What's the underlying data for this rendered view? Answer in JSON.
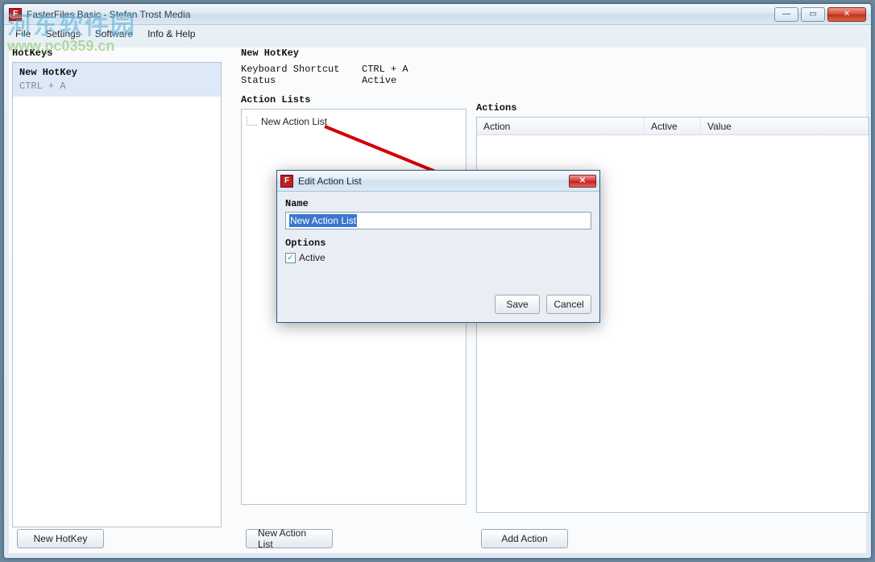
{
  "window": {
    "title": "FasterFiles Basic - Stefan Trost Media",
    "app_icon_letter": "F"
  },
  "menu": {
    "file": "File",
    "settings": "Settings",
    "software": "Software",
    "info": "Info & Help"
  },
  "labels": {
    "hotkeys": "HotKeys",
    "new_hotkey": "New HotKey",
    "kv_keyboard": "Keyboard Shortcut",
    "kv_status": "Status",
    "kv_keyboard_val": "CTRL + A",
    "kv_status_val": "Active",
    "action_lists": "Action Lists",
    "actions": "Actions"
  },
  "hotkey_item": {
    "name": "New HotKey",
    "key": "CTRL + A"
  },
  "tree": {
    "item0": "New Action List"
  },
  "table": {
    "col_action": "Action",
    "col_active": "Active",
    "col_value": "Value"
  },
  "buttons": {
    "new_hotkey": "New HotKey",
    "new_action_list": "New Action List",
    "add_action": "Add Action"
  },
  "dialog": {
    "title": "Edit Action List",
    "name_label": "Name",
    "name_value": "New Action List",
    "options_label": "Options",
    "active_label": "Active",
    "active_checked": true,
    "save": "Save",
    "cancel": "Cancel"
  },
  "window_controls": {
    "minimize": "—",
    "maximize": "▭",
    "close": "✕"
  },
  "watermark": {
    "line1": "河东软件园",
    "line2": "www.pc0359.cn"
  }
}
